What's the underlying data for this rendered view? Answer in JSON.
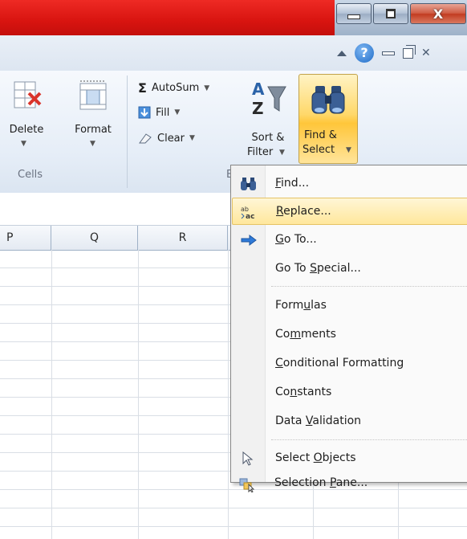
{
  "window": {
    "minimize_glyph": "minimize",
    "maximize_glyph": "maximize",
    "close_glyph": "X"
  },
  "ribbon": {
    "cells_group": {
      "label": "Cells",
      "delete_label": "Delete",
      "format_label": "Format"
    },
    "editing_group": {
      "label_partial": "E",
      "autosum_label": "AutoSum",
      "fill_label": "Fill",
      "clear_label": "Clear",
      "sort_label_line1": "Sort &",
      "sort_label_line2": "Filter",
      "find_label_line1": "Find &",
      "find_label_line2": "Select"
    },
    "help_glyph": "?"
  },
  "grid": {
    "columns": [
      "P",
      "Q",
      "R"
    ]
  },
  "menu": {
    "items": [
      {
        "label": "Find...",
        "accel": "F",
        "icon": "binoculars-icon"
      },
      {
        "label": "Replace...",
        "accel": "R",
        "icon": "replace-icon",
        "highlighted": true
      },
      {
        "label": "Go To...",
        "accel": "G",
        "icon": "arrow-right-icon"
      },
      {
        "label": "Go To Special...",
        "accel": "S"
      },
      {
        "label": "Formulas",
        "accel": "u"
      },
      {
        "label": "Comments",
        "accel": "m"
      },
      {
        "label": "Conditional Formatting",
        "accel": "C"
      },
      {
        "label": "Constants",
        "accel": "n"
      },
      {
        "label": "Data Validation",
        "accel": "V"
      },
      {
        "label": "Select Objects",
        "accel": "O",
        "icon": "cursor-icon"
      },
      {
        "label": "Selection Pane...",
        "accel": "P",
        "icon": "selection-pane-icon"
      }
    ]
  }
}
